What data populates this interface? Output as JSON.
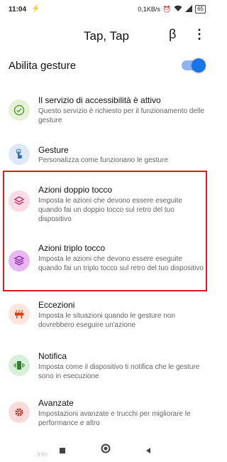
{
  "status": {
    "time": "11:04",
    "network_speed": "0,1KB/s",
    "battery": "65",
    "bolt_icon": "bolt-icon",
    "wifi_icon": "wifi-icon"
  },
  "app": {
    "title": "Tap, Tap",
    "beta_label": "β",
    "more_icon": "more-vert-icon"
  },
  "toggle": {
    "label": "Abilita gesture",
    "enabled": true
  },
  "items": [
    {
      "title": "Il servizio di accessibilità è attivo",
      "description": "Questo servizio è richiesto per il funzionamento delle gesture",
      "icon": "check-circle-icon",
      "color": "#5a9e3a",
      "bg": "#e6f2d8"
    },
    {
      "title": "Gesture",
      "description": "Personalizza come funzionano le gesture",
      "icon": "touch-icon",
      "color": "#2e6fb3",
      "bg": "#dfe9f7"
    },
    {
      "title": "Azioni doppio tocco",
      "description": "Imposta le azioni che devono essere eseguite quando fai un doppio tocco sul retro del tuo dispositivo",
      "icon": "layers-icon",
      "color": "#c2185b",
      "bg": "#fadbe6"
    },
    {
      "title": "Azioni triplo tocco",
      "description": "Imposta le azioni che devono essere eseguite quando fai un triplo tocco sul retro del tuo dispositivo",
      "icon": "layers-triple-icon",
      "color": "#8e24aa",
      "bg": "#e7b8f2"
    },
    {
      "title": "Eccezioni",
      "description": "Imposta le situazioni quando le gesture non dovrebbero eseguire un'azione",
      "icon": "exception-icon",
      "color": "#d84315",
      "bg": "#fde6dc"
    },
    {
      "title": "Notifica",
      "description": "Imposta come il dispositivo ti notifica che le gesture sono in esecuzione",
      "icon": "vibration-icon",
      "color": "#2e7d32",
      "bg": "#d8efd9"
    },
    {
      "title": "Avanzate",
      "description": "Impostazioni avanzate e trucchi per migliorare le performance e altro",
      "icon": "gear-icon",
      "color": "#c62828",
      "bg": "#fbdada"
    }
  ],
  "footer": {
    "ghost_text": "Info"
  }
}
